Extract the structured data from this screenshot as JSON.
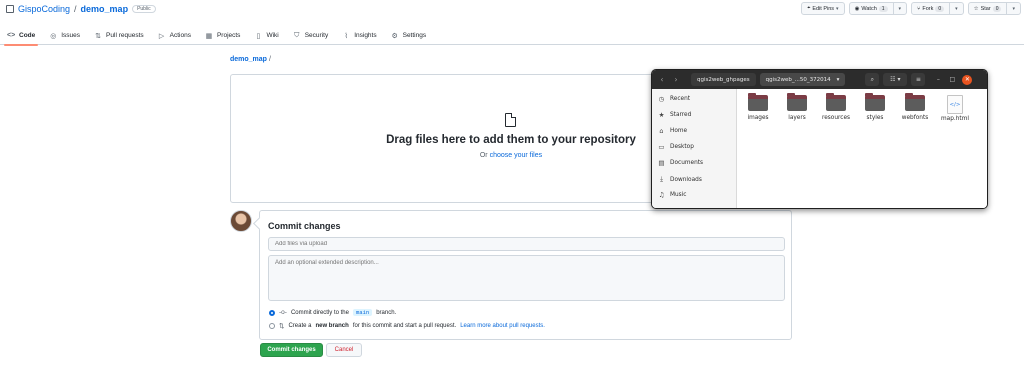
{
  "repo": {
    "owner": "GispoCoding",
    "separator": "/",
    "name": "demo_map",
    "visibility": "Public"
  },
  "header_actions": {
    "edit_pins": "Edit Pins",
    "watch": {
      "label": "Watch",
      "count": "1"
    },
    "fork": {
      "label": "Fork",
      "count": "0"
    },
    "star": {
      "label": "Star",
      "count": "0"
    }
  },
  "tabs": [
    {
      "label": "Code",
      "icon": "code-icon",
      "glyph": "<>"
    },
    {
      "label": "Issues",
      "icon": "issue-icon",
      "glyph": "◎"
    },
    {
      "label": "Pull requests",
      "icon": "pull-request-icon",
      "glyph": "⇅"
    },
    {
      "label": "Actions",
      "icon": "play-icon",
      "glyph": "▷"
    },
    {
      "label": "Projects",
      "icon": "table-icon",
      "glyph": "▦"
    },
    {
      "label": "Wiki",
      "icon": "book-icon",
      "glyph": "▯"
    },
    {
      "label": "Security",
      "icon": "shield-icon",
      "glyph": "⛉"
    },
    {
      "label": "Insights",
      "icon": "graph-icon",
      "glyph": "⌇"
    },
    {
      "label": "Settings",
      "icon": "gear-icon",
      "glyph": "⚙"
    }
  ],
  "breadcrumb": {
    "repo": "demo_map",
    "sep": "/"
  },
  "dropzone": {
    "title": "Drag files here to add them to your repository",
    "or_text": "Or",
    "choose_link": "choose your files"
  },
  "commit": {
    "title": "Commit changes",
    "summary_placeholder": "Add files via upload",
    "description_placeholder": "Add an optional extended description...",
    "option_direct": {
      "prefix": "Commit directly to the",
      "branch": "main",
      "suffix": "branch."
    },
    "option_new": {
      "prefix": "Create a",
      "bold": "new branch",
      "suffix": "for this commit and start a pull request.",
      "link": "Learn more about pull requests."
    },
    "commit_button": "Commit changes",
    "cancel_button": "Cancel"
  },
  "file_manager": {
    "path": [
      "qgis2web_ghpages",
      "qgis2web_...50_372014"
    ],
    "sidebar": [
      {
        "label": "Recent",
        "icon": "clock-icon"
      },
      {
        "label": "Starred",
        "icon": "star-icon"
      },
      {
        "label": "Home",
        "icon": "home-icon"
      },
      {
        "label": "Desktop",
        "icon": "desktop-icon"
      },
      {
        "label": "Documents",
        "icon": "document-icon"
      },
      {
        "label": "Downloads",
        "icon": "download-icon"
      },
      {
        "label": "Music",
        "icon": "music-icon"
      }
    ],
    "items": [
      {
        "name": "images",
        "kind": "folder"
      },
      {
        "name": "layers",
        "kind": "folder"
      },
      {
        "name": "resources",
        "kind": "folder"
      },
      {
        "name": "styles",
        "kind": "folder"
      },
      {
        "name": "webfonts",
        "kind": "folder"
      },
      {
        "name": "map.html",
        "kind": "html"
      }
    ]
  },
  "colors": {
    "link": "#0969da",
    "primary_button": "#2da44e",
    "danger": "#cf222e",
    "tab_underline": "#fd8c73",
    "fm_titlebar": "#2c2c2c",
    "fm_close": "#e95420"
  }
}
